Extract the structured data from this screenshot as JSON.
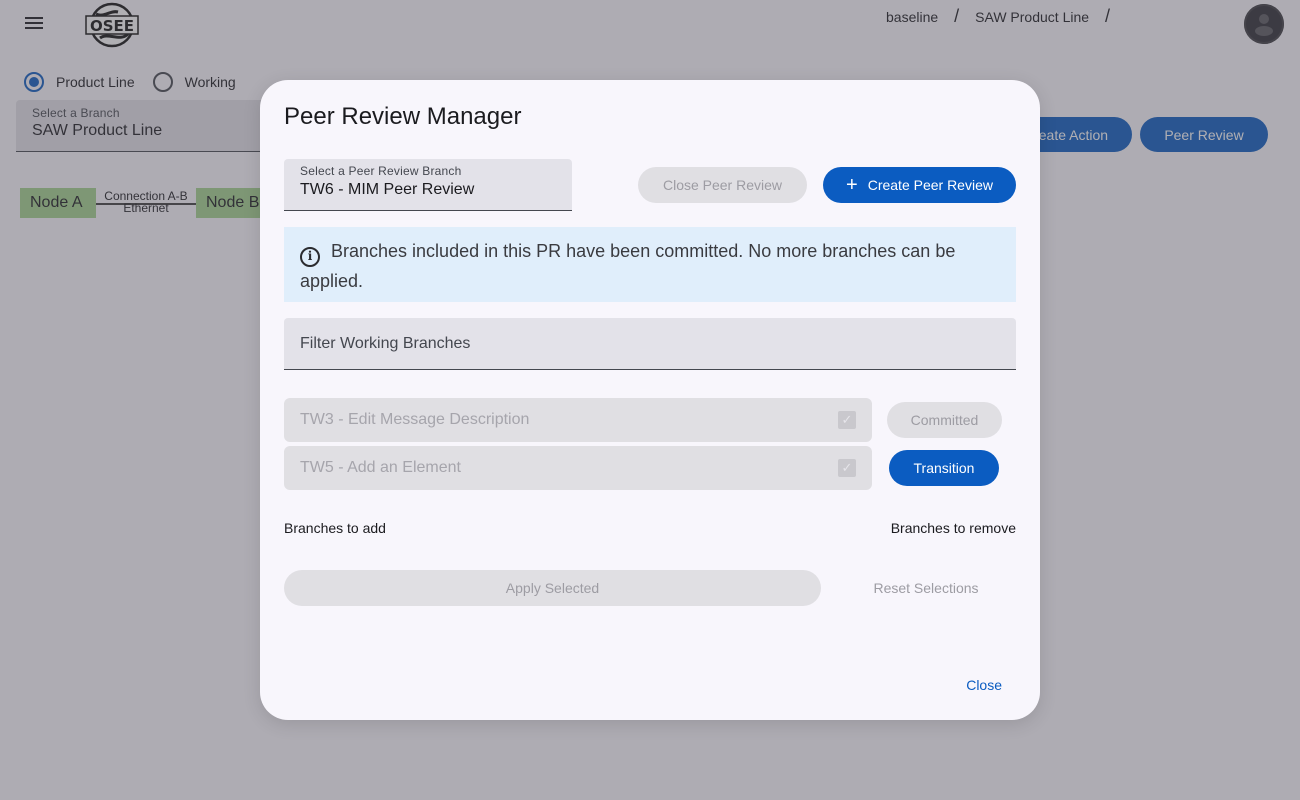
{
  "header": {
    "logo_text": "OSEE",
    "breadcrumb": [
      "baseline",
      "SAW Product Line"
    ],
    "breadcrumb_separator": "/"
  },
  "branch_type": {
    "options": [
      {
        "label": "Product Line",
        "checked": true
      },
      {
        "label": "Working",
        "checked": false
      }
    ]
  },
  "branch_select": {
    "label": "Select a Branch",
    "value": "SAW Product Line"
  },
  "toolbar": {
    "create_action_label": "Create Action",
    "create_action_visible_text": "eate Action",
    "peer_review_label": "Peer Review"
  },
  "diagram": {
    "nodes": [
      "Node A",
      "Node B"
    ],
    "edge": {
      "label": "Connection A-B",
      "sublabel": "Ethernet"
    }
  },
  "dialog": {
    "title": "Peer Review Manager",
    "pr_select": {
      "label": "Select a Peer Review Branch",
      "value": "TW6 - MIM Peer Review"
    },
    "close_pr_label": "Close Peer Review",
    "create_pr_label": "Create Peer Review",
    "alert": {
      "icon": "info-icon",
      "text": "Branches included in this PR have been committed. No more branches can be applied."
    },
    "filter_placeholder": "Filter Working Branches",
    "branches": [
      {
        "name": "TW3 - Edit Message Description",
        "checked": true,
        "status": "Committed"
      },
      {
        "name": "TW5 - Add an Element",
        "checked": true,
        "status": "Transition"
      }
    ],
    "branches_to_add_label": "Branches to add",
    "branches_to_remove_label": "Branches to remove",
    "apply_label": "Apply Selected",
    "reset_label": "Reset Selections",
    "close_label": "Close"
  },
  "colors": {
    "primary": "#0b5cc1",
    "node_fill": "#a5d48e",
    "alert_bg": "#e0eefb"
  }
}
